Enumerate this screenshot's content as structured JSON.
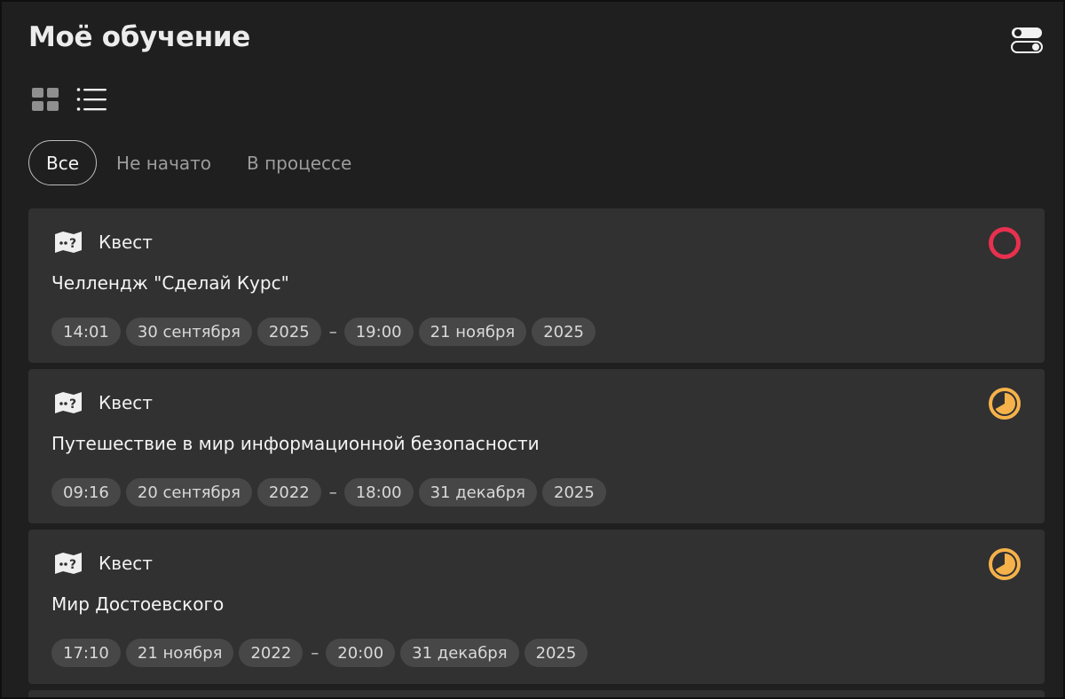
{
  "page": {
    "title": "Моё обучение"
  },
  "filters": [
    {
      "label": "Все",
      "active": true
    },
    {
      "label": "Не начато",
      "active": false
    },
    {
      "label": "В процессе",
      "active": false
    }
  ],
  "colors": {
    "status_not_started": "#e8304f",
    "status_in_progress": "#f5b24a"
  },
  "icons": {
    "settings": "toggle-switches-icon",
    "grid_view": "grid-view-icon",
    "list_view": "list-view-icon",
    "type": "quest-map-icon"
  },
  "cards": [
    {
      "type_label": "Квест",
      "title": "Челлендж \"Сделай Курс\"",
      "status": "not-started",
      "start": {
        "time": "14:01",
        "date": "30 сентября",
        "year": "2025"
      },
      "separator": "–",
      "end": {
        "time": "19:00",
        "date": "21 ноября",
        "year": "2025"
      }
    },
    {
      "type_label": "Квест",
      "title": "Путешествие в мир информационной безопасности",
      "status": "in-progress",
      "start": {
        "time": "09:16",
        "date": "20 сентября",
        "year": "2022"
      },
      "separator": "–",
      "end": {
        "time": "18:00",
        "date": "31 декабря",
        "year": "2025"
      }
    },
    {
      "type_label": "Квест",
      "title": "Мир Достоевского",
      "status": "in-progress",
      "start": {
        "time": "17:10",
        "date": "21 ноября",
        "year": "2022"
      },
      "separator": "–",
      "end": {
        "time": "20:00",
        "date": "31 декабря",
        "year": "2025"
      }
    }
  ]
}
